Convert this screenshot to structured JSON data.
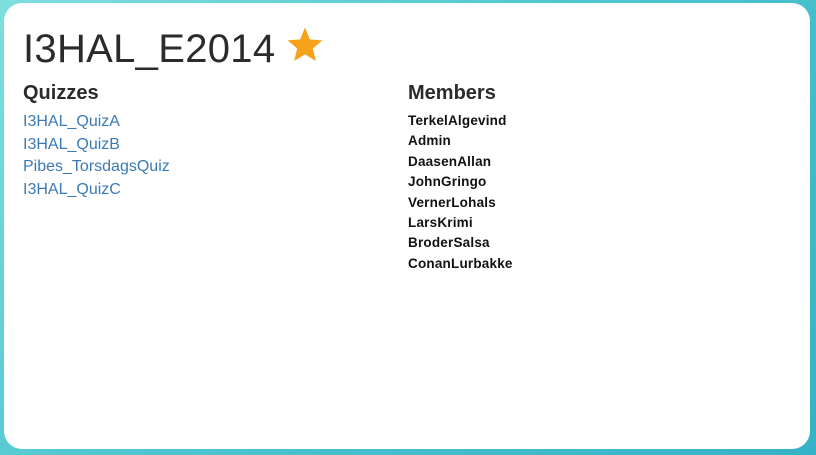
{
  "group": {
    "title": "I3HAL_E2014",
    "favorite_icon": "star-icon",
    "favorite_color": "#f7a21b"
  },
  "quizzes": {
    "heading": "Quizzes",
    "link_color": "#3b7ab5",
    "items": [
      {
        "label": "I3HAL_QuizA"
      },
      {
        "label": "I3HAL_QuizB"
      },
      {
        "label": "Pibes_TorsdagsQuiz"
      },
      {
        "label": "I3HAL_QuizC"
      }
    ]
  },
  "members": {
    "heading": "Members",
    "items": [
      {
        "name": "TerkelAlgevind"
      },
      {
        "name": "Admin"
      },
      {
        "name": "DaasenAllan"
      },
      {
        "name": "JohnGringo"
      },
      {
        "name": "VernerLohals"
      },
      {
        "name": "LarsKrimi"
      },
      {
        "name": "BroderSalsa"
      },
      {
        "name": "ConanLurbakke"
      }
    ]
  }
}
